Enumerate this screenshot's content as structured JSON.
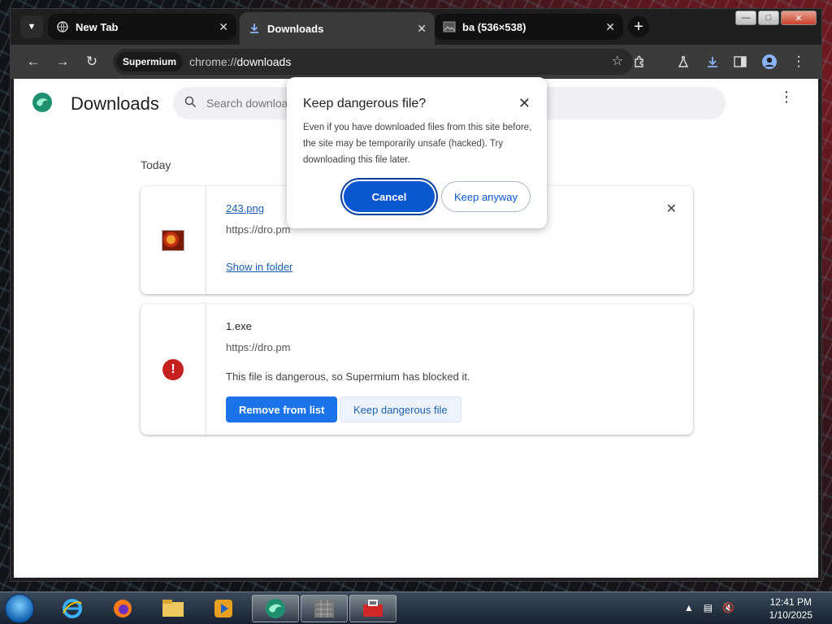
{
  "tabs": [
    {
      "title": "New Tab",
      "icon": "globe-icon"
    },
    {
      "title": "Downloads",
      "icon": "download-icon"
    },
    {
      "title": "ba (536×538)",
      "icon": "image-icon"
    }
  ],
  "toolbar": {
    "site_chip": "Supermium",
    "url_scheme": "chrome://",
    "url_path": "downloads"
  },
  "page": {
    "title": "Downloads",
    "search_placeholder": "Search downloads",
    "date_label": "Today"
  },
  "downloads": [
    {
      "file_name": "243.png",
      "source": "https://dro.pm",
      "action_label": "Show in folder"
    },
    {
      "file_name": "1.exe",
      "source": "https://dro.pm",
      "warning": "This file is dangerous, so Supermium has blocked it.",
      "remove_label": "Remove from list",
      "keep_label": "Keep dangerous file"
    }
  ],
  "dialog": {
    "title": "Keep dangerous file?",
    "body": "Even if you have downloaded files from this site before, the site may be temporarily unsafe (hacked). Try downloading this file later.",
    "cancel_label": "Cancel",
    "keep_label": "Keep anyway"
  },
  "clock": {
    "time": "12:41 PM",
    "date": "1/10/2025"
  },
  "colors": {
    "accent": "#1a73e8",
    "dialog_primary": "#0b57d0",
    "danger": "#c5221f"
  }
}
